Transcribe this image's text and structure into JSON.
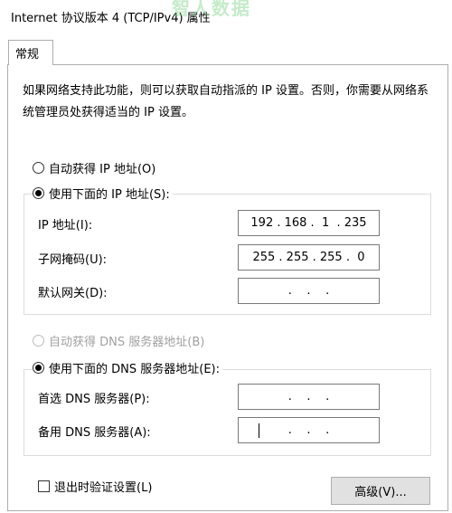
{
  "window": {
    "title": "Internet 协议版本 4 (TCP/IPv4) 属性",
    "watermark": "智人数据"
  },
  "tabs": [
    {
      "label": "常规",
      "selected": true
    }
  ],
  "description": "如果网络支持此功能，则可以获取自动指派的 IP 设置。否则，你需要从网络系统管理员处获得适当的 IP 设置。",
  "ip_section": {
    "auto_option": {
      "label": "自动获得 IP 地址(O)",
      "selected": false
    },
    "manual_option": {
      "label": "使用下面的 IP 地址(S):",
      "selected": true
    },
    "fields": [
      {
        "label": "IP 地址(I):",
        "value": "192 . 168 .  1  . 235"
      },
      {
        "label": "子网掩码(U):",
        "value": "255 . 255 . 255 .  0"
      },
      {
        "label": "默认网关(D):",
        "value": " .    .    . "
      }
    ]
  },
  "dns_section": {
    "auto_option": {
      "label": "自动获得 DNS 服务器地址(B)",
      "selected": false,
      "disabled": true
    },
    "manual_option": {
      "label": "使用下面的 DNS 服务器地址(E):",
      "selected": true
    },
    "fields": [
      {
        "label": "首选 DNS 服务器(P):",
        "value": " .    .    . "
      },
      {
        "label": "备用 DNS 服务器(A):",
        "value": " .    .    . ",
        "focused": true
      }
    ]
  },
  "validate_checkbox": {
    "label": "退出时验证设置(L)",
    "checked": false
  },
  "advanced_button": {
    "label": "高级(V)..."
  },
  "colors": {
    "border": "#adadad",
    "group_border": "#dcdcdc",
    "disabled_text": "#a0a0a0",
    "button_bg": "#e1e1e1"
  }
}
